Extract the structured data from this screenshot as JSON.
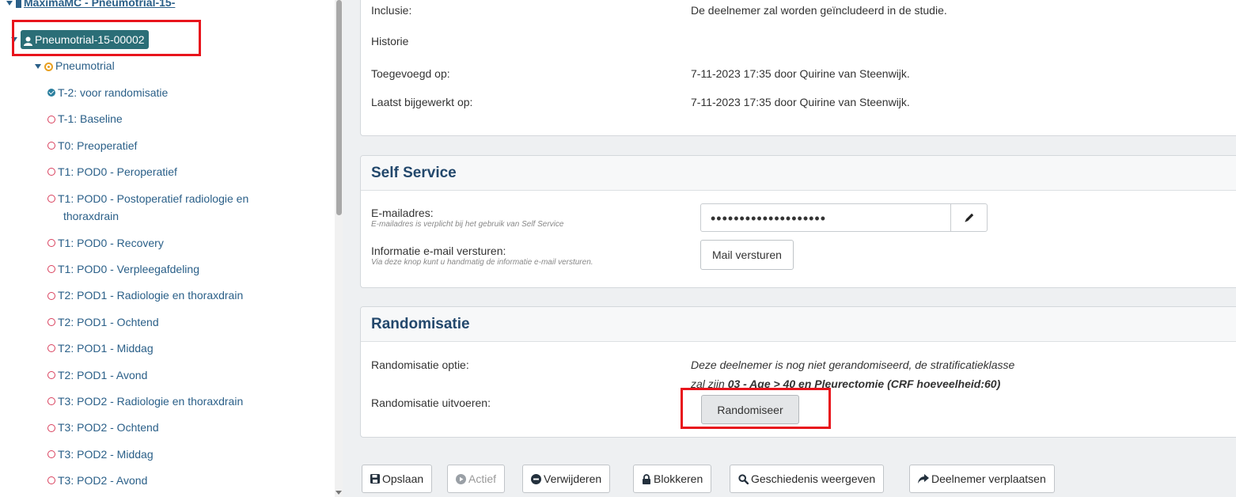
{
  "sidebar": {
    "org_label": "MáximaMC - Pneumotrial-15-",
    "participant_label": "Pneumotrial-15-00002",
    "study_label": "Pneumotrial",
    "visits": [
      {
        "label": "T-2: voor randomisatie",
        "status": "completed"
      },
      {
        "label": "T-1: Baseline",
        "status": "open"
      },
      {
        "label": "T0: Preoperatief",
        "status": "open"
      },
      {
        "label": "T1: POD0 - Peroperatief",
        "status": "open"
      },
      {
        "label": "T1: POD0 - Postoperatief radiologie en",
        "label_cont": "thoraxdrain",
        "status": "open"
      },
      {
        "label": "T1: POD0 - Recovery",
        "status": "open"
      },
      {
        "label": "T1: POD0 - Verpleegafdeling",
        "status": "open"
      },
      {
        "label": "T2: POD1 - Radiologie en thoraxdrain",
        "status": "open"
      },
      {
        "label": "T2: POD1 - Ochtend",
        "status": "open"
      },
      {
        "label": "T2: POD1 - Middag",
        "status": "open"
      },
      {
        "label": "T2: POD1 - Avond",
        "status": "open"
      },
      {
        "label": "T3: POD2 - Radiologie en thoraxdrain",
        "status": "open"
      },
      {
        "label": "T3: POD2 - Ochtend",
        "status": "open"
      },
      {
        "label": "T3: POD2 - Middag",
        "status": "open"
      },
      {
        "label": "T3: POD2 - Avond",
        "status": "open"
      }
    ]
  },
  "details": {
    "inclusie_label": "Inclusie:",
    "inclusie_value": "De deelnemer zal worden geïncludeerd in de studie.",
    "historie_label": "Historie",
    "added_label": "Toegevoegd op:",
    "added_value": "7-11-2023 17:35 door Quirine van Steenwijk.",
    "updated_label": "Laatst bijgewerkt op:",
    "updated_value": "7-11-2023 17:35 door Quirine van Steenwijk."
  },
  "self_service": {
    "heading": "Self Service",
    "email_label": "E-mailadres:",
    "email_sub": "E-mailadres is verplicht bij het gebruik van Self Service",
    "email_value": "••••••••••••••••••••",
    "info_label": "Informatie e-mail versturen:",
    "info_sub": "Via deze knop kunt u handmatig de informatie e-mail versturen.",
    "mail_button": "Mail versturen"
  },
  "randomisatie": {
    "heading": "Randomisatie",
    "option_label": "Randomisatie optie:",
    "option_text_1": "Deze deelnemer is nog niet gerandomiseerd, de stratificatieklasse",
    "option_text_2_prefix": "zal zijn ",
    "option_text_2_bold": "03 - Age > 40 en Pleurectomie (CRF hoeveelheid:60)",
    "execute_label": "Randomisatie uitvoeren:",
    "execute_button": "Randomiseer"
  },
  "footer": {
    "save": "Opslaan",
    "active": "Actief",
    "delete": "Verwijderen",
    "block": "Blokkeren",
    "history": "Geschiedenis weergeven",
    "move": "Deelnemer verplaatsen"
  },
  "colors": {
    "accent": "#23486c",
    "participant_chip": "#2b6e77",
    "open_visit": "#d9415e",
    "completed_visit": "#2b7f9e",
    "highlight": "#e8141c"
  }
}
